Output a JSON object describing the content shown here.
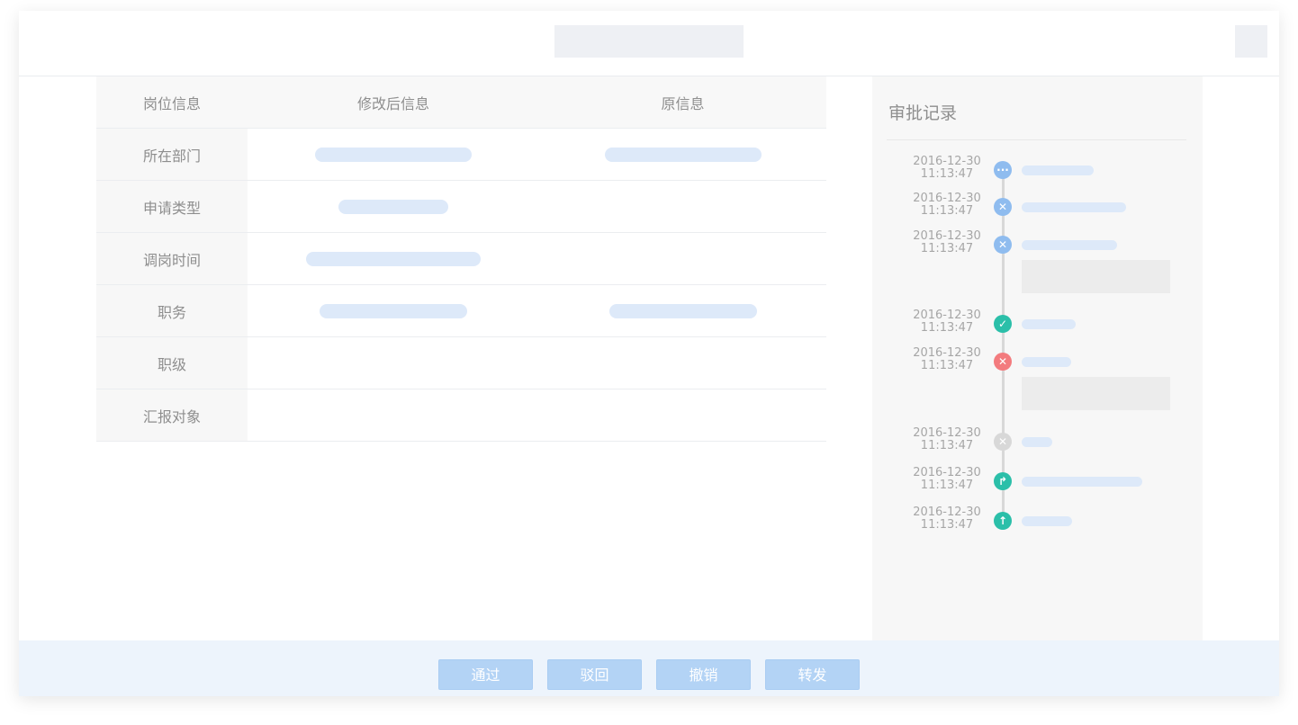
{
  "table": {
    "headers": [
      "岗位信息",
      "修改后信息",
      "原信息"
    ],
    "rows": [
      {
        "label": "所在部门"
      },
      {
        "label": "申请类型"
      },
      {
        "label": "调岗时间"
      },
      {
        "label": "职务"
      },
      {
        "label": "职级"
      },
      {
        "label": "汇报对象"
      }
    ]
  },
  "approval": {
    "title": "审批记录",
    "records": [
      {
        "date": "2016-12-30",
        "time": "11:13:47",
        "icon": "more-icon",
        "color": "#8fbcef"
      },
      {
        "date": "2016-12-30",
        "time": "11:13:47",
        "icon": "close-icon",
        "color": "#8fbcef"
      },
      {
        "date": "2016-12-30",
        "time": "11:13:47",
        "icon": "close-icon",
        "color": "#8fbcef"
      },
      {
        "date": "2016-12-30",
        "time": "11:13:47",
        "icon": "check-icon",
        "color": "#2bbfa9"
      },
      {
        "date": "2016-12-30",
        "time": "11:13:47",
        "icon": "close-icon",
        "color": "#f37b7e"
      },
      {
        "date": "2016-12-30",
        "time": "11:13:47",
        "icon": "close-icon",
        "color": "#d8d8d8"
      },
      {
        "date": "2016-12-30",
        "time": "11:13:47",
        "icon": "forward-icon",
        "color": "#2bbfa9"
      },
      {
        "date": "2016-12-30",
        "time": "11:13:47",
        "icon": "arrow-up-icon",
        "color": "#2bbfa9"
      }
    ]
  },
  "footer": {
    "approve_label": "通过",
    "reject_label": "驳回",
    "revoke_label": "撤销",
    "forward_label": "转发"
  }
}
